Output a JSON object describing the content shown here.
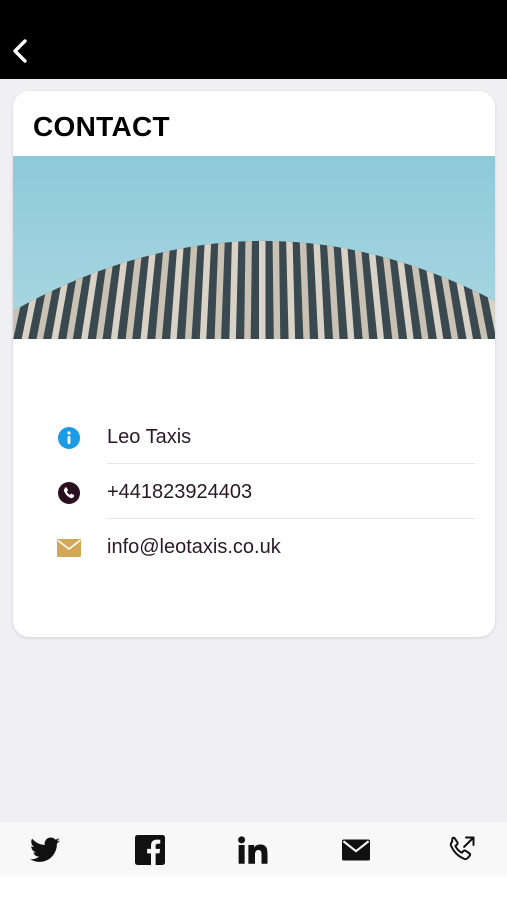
{
  "header": {
    "back_icon": "chevron-left-icon"
  },
  "card": {
    "title": "CONTACT",
    "image": "building-facade-photo",
    "rows": [
      {
        "icon": "info-icon",
        "icon_color": "#1a9be6",
        "text": "Leo Taxis"
      },
      {
        "icon": "phone-icon",
        "icon_color": "#2a0f1e",
        "text": "+441823924403"
      },
      {
        "icon": "mail-icon",
        "icon_color": "#d2a858",
        "text": "info@leotaxis.co.uk"
      }
    ]
  },
  "bottom_bar": {
    "items": [
      {
        "icon": "twitter-icon"
      },
      {
        "icon": "facebook-icon"
      },
      {
        "icon": "linkedin-icon"
      },
      {
        "icon": "email-icon"
      },
      {
        "icon": "call-icon"
      }
    ]
  }
}
